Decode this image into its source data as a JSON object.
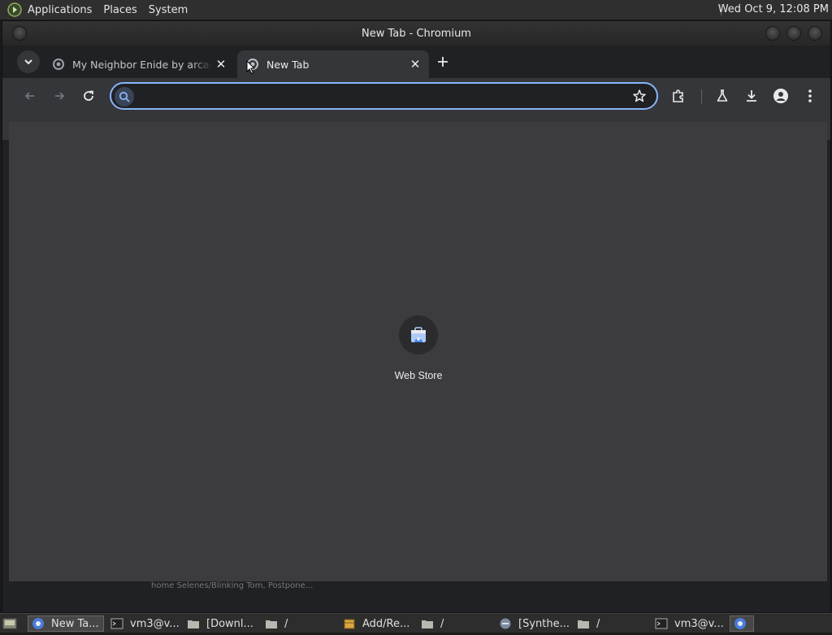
{
  "top_panel": {
    "menus": [
      "Applications",
      "Places",
      "System"
    ],
    "clock": "Wed Oct  9, 12:08 PM"
  },
  "window": {
    "title": "New Tab - Chromium"
  },
  "tabs": [
    {
      "title": "My Neighbor Enide by arcade",
      "active": false,
      "icon": "chromium-icon"
    },
    {
      "title": "New Tab",
      "active": true,
      "icon": "chromium-icon"
    }
  ],
  "omnibox": {
    "value": "",
    "placeholder": ""
  },
  "shortcuts": [
    {
      "label": "Web Store",
      "icon": "web-store-icon"
    }
  ],
  "background_window_text": "home Selenes/Blinking Tom, Postpone...",
  "taskbar": {
    "items": [
      {
        "label": "New Ta...",
        "icon": "chromium-icon",
        "active": true
      },
      {
        "label": "vm3@v...",
        "icon": "terminal-icon",
        "active": false
      },
      {
        "label": "[Downl...",
        "icon": "folder-icon",
        "active": false
      },
      {
        "label": "/",
        "icon": "folder-icon",
        "active": false
      },
      {
        "label": "Add/Re...",
        "icon": "package-icon",
        "active": false
      },
      {
        "label": "/",
        "icon": "folder-icon",
        "active": false
      },
      {
        "label": "[Synthe...",
        "icon": "app-icon",
        "active": false
      },
      {
        "label": "/",
        "icon": "folder-icon",
        "active": false
      },
      {
        "label": "vm3@v...",
        "icon": "terminal-icon",
        "active": false
      },
      {
        "label": "",
        "icon": "chromium-icon",
        "active": false
      }
    ]
  },
  "colors": {
    "accent": "#8ab4f8",
    "toolbar": "#35363a",
    "content_bg": "#3c3c40"
  }
}
